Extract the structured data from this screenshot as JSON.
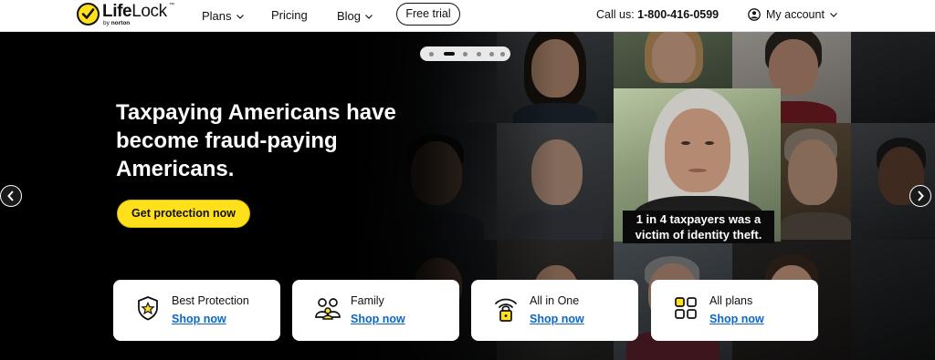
{
  "header": {
    "logo": {
      "word_bold": "Life",
      "word_light": "Lock",
      "trademark": "™",
      "by": "by",
      "brand": "norton"
    },
    "nav": [
      {
        "label": "Plans",
        "has_dropdown": true
      },
      {
        "label": "Pricing",
        "has_dropdown": false
      },
      {
        "label": "Blog",
        "has_dropdown": true
      }
    ],
    "free_trial_label": "Free trial",
    "call_prefix": "Call us:",
    "phone": "1-800-416-0599",
    "account_label": "My account"
  },
  "hero": {
    "headline": "Taxpaying Americans have become fraud-paying Americans.",
    "cta_label": "Get protection now",
    "caption": "1 in 4 taxpayers was a victim of identity theft.",
    "carousel": {
      "total_slides": 6,
      "active_index": 1
    },
    "prev_icon": "chevron-left-icon",
    "next_icon": "chevron-right-icon"
  },
  "cards": [
    {
      "title": "Best Protection",
      "link": "Shop now",
      "icon": "shield-star-icon"
    },
    {
      "title": "Family",
      "link": "Shop now",
      "icon": "family-icon"
    },
    {
      "title": "All in One",
      "link": "Shop now",
      "icon": "wifi-lock-icon"
    },
    {
      "title": "All plans",
      "link": "Shop now",
      "icon": "grid-plans-icon"
    }
  ],
  "colors": {
    "brand_yellow": "#ffe01b",
    "link_blue": "#0b67c9",
    "hero_background": "#000000"
  }
}
